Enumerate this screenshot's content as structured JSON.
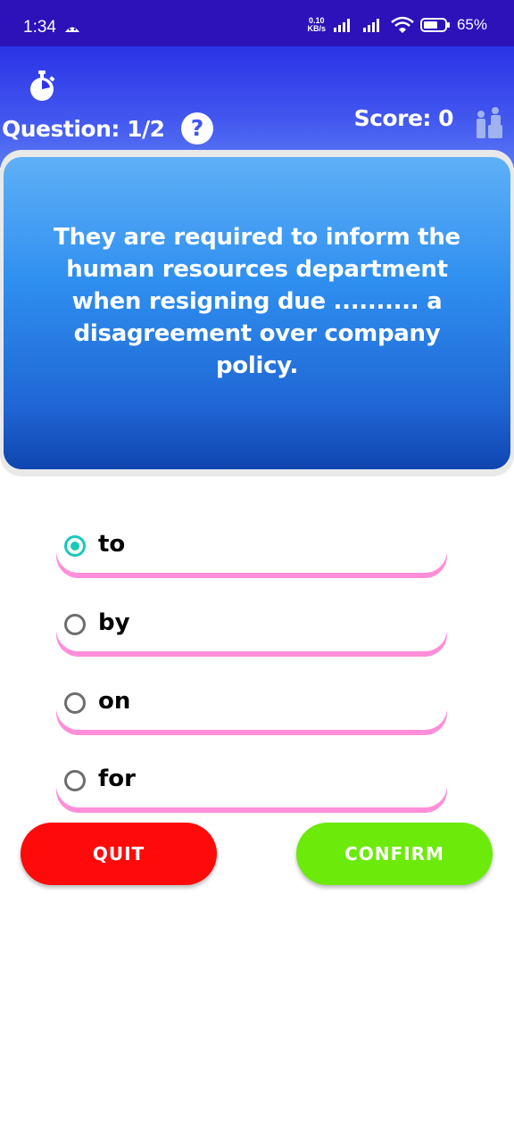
{
  "status_bar": {
    "time": "1:34",
    "net_speed_value": "0.10",
    "net_speed_unit": "KB/s",
    "battery": "65%"
  },
  "header": {
    "question_counter": "Question: 1/2",
    "help_symbol": "?",
    "score": "Score: 0",
    "icons": [
      "timer-icon",
      "help-icon",
      "leaderboard-icon"
    ]
  },
  "question": {
    "text": "They are required to inform the human resources department when resigning due .......... a disagreement over company policy."
  },
  "options": [
    {
      "label": "to",
      "selected": true
    },
    {
      "label": "by",
      "selected": false
    },
    {
      "label": "on",
      "selected": false
    },
    {
      "label": "for",
      "selected": false
    }
  ],
  "buttons": {
    "quit": "QUIT",
    "confirm": "CONFIRM"
  },
  "colors": {
    "status_bar": "#2c12b8",
    "header": "#4257ef",
    "card": "#2f8ff0",
    "option_shadow": "#ff8fd8",
    "radio_selected": "#18c9b6",
    "quit": "#ff0a0a",
    "confirm": "#6cea0a"
  }
}
